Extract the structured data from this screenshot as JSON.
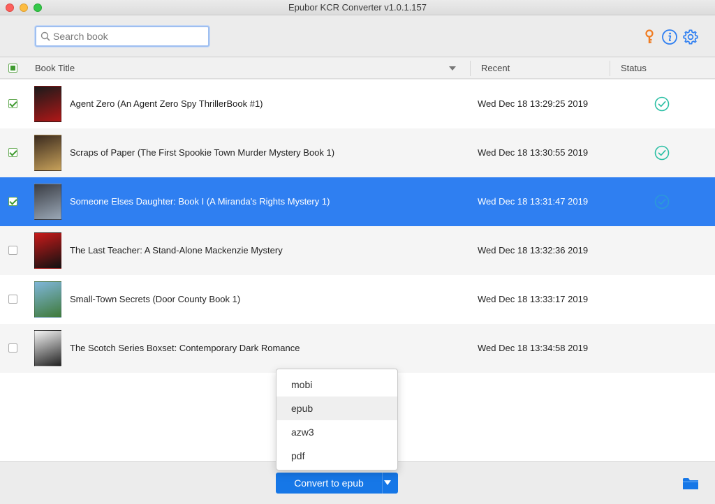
{
  "window": {
    "title": "Epubor KCR Converter v1.0.1.157"
  },
  "search": {
    "placeholder": "Search book"
  },
  "columns": {
    "title": "Book Title",
    "recent": "Recent",
    "status": "Status"
  },
  "books": [
    {
      "title": "Agent Zero (An Agent Zero Spy ThrillerBook #1)",
      "recent": "Wed Dec 18 13:29:25 2019",
      "checked": true,
      "converted": true,
      "selected": false,
      "cover_colors": [
        "#1a1a1a",
        "#b01818"
      ]
    },
    {
      "title": "Scraps of Paper (The First Spookie Town Murder Mystery Book 1)",
      "recent": "Wed Dec 18 13:30:55 2019",
      "checked": true,
      "converted": true,
      "selected": false,
      "cover_colors": [
        "#3a2a1e",
        "#c7a15a"
      ]
    },
    {
      "title": "Someone Elses Daughter: Book I (A Miranda's Rights Mystery 1)",
      "recent": "Wed Dec 18 13:31:47 2019",
      "checked": true,
      "converted": true,
      "selected": true,
      "cover_colors": [
        "#3a3d44",
        "#9aa7b6"
      ]
    },
    {
      "title": "The Last Teacher: A Stand-Alone Mackenzie Mystery",
      "recent": "Wed Dec 18 13:32:36 2019",
      "checked": false,
      "converted": false,
      "selected": false,
      "cover_colors": [
        "#c81a1a",
        "#111111"
      ]
    },
    {
      "title": "Small-Town Secrets (Door County Book 1)",
      "recent": "Wed Dec 18 13:33:17 2019",
      "checked": false,
      "converted": false,
      "selected": false,
      "cover_colors": [
        "#7fb6d9",
        "#3f7a3a"
      ]
    },
    {
      "title": "The Scotch Series Boxset: Contemporary Dark Romance",
      "recent": "Wed Dec 18 13:34:58 2019",
      "checked": false,
      "converted": false,
      "selected": false,
      "cover_colors": [
        "#f4f4f4",
        "#222222"
      ]
    }
  ],
  "format_menu": {
    "options": [
      "mobi",
      "epub",
      "azw3",
      "pdf"
    ],
    "hovered": "epub"
  },
  "convert_button": {
    "label": "Convert to epub"
  },
  "colors": {
    "accent": "#2f7ff1",
    "button": "#1677e7",
    "status_ok": "#2bbfa4",
    "key": "#f07c22",
    "info": "#2f7ff1"
  },
  "icons": {
    "key": "key-icon",
    "info": "info-icon",
    "settings": "gear-icon",
    "folder": "folder-icon",
    "status": "check-circle-icon"
  }
}
